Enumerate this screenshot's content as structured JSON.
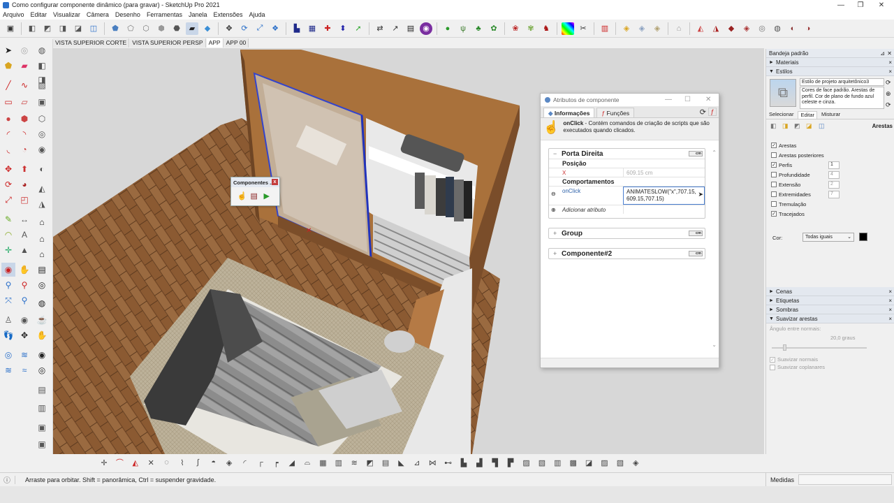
{
  "window": {
    "title": "Como configurar componente dinâmico (para gravar) - SketchUp Pro 2021",
    "minimize": "—",
    "restore": "❐",
    "close": "✕"
  },
  "menu": [
    "Arquivo",
    "Editar",
    "Visualizar",
    "Câmera",
    "Desenho",
    "Ferramentas",
    "Janela",
    "Extensões",
    "Ajuda"
  ],
  "scene_tabs": [
    "VISTA SUPERIOR CORTE",
    "VISTA SUPERIOR PERSP",
    "APP",
    "APP 00"
  ],
  "components_window": {
    "title": "Componentes ...",
    "close": "x"
  },
  "attributes_window": {
    "title": "Atributos de componente",
    "tab_info": "Informações",
    "tab_functions": "Funções",
    "help_title": "onClick",
    "help_text": " - Contém comandos de criação de scripts que são executados quando clicados.",
    "sections": [
      {
        "name": "Porta Direita",
        "unit": "cm",
        "expander": "−"
      },
      {
        "name": "Group",
        "unit": "cm",
        "expander": "+"
      },
      {
        "name": "Componente#2",
        "unit": "cm",
        "expander": "+"
      }
    ],
    "position_label": "Posição",
    "x_label": "X",
    "x_value": "609.15 cm",
    "behaviors_label": "Comportamentos",
    "onclick_label": "onClick",
    "onclick_value": "ANIMATESLOW(\"x\",707.15, 609.15,707.15)",
    "add_attribute": "Adicionar atributo"
  },
  "tray": {
    "title": "Bandeja padrão",
    "panels": [
      "Materiais",
      "Estilos"
    ],
    "style_name": "Estilo de projeto arquitetônico3",
    "style_desc": "Cores de face padrão. Arestas de perfil. Cor de plano de fundo azul celeste e cinza.",
    "style_tabs": [
      "Selecionar",
      "Editar",
      "Misturar"
    ],
    "edges_label": "Arestas",
    "options": [
      {
        "label": "Arestas",
        "checked": true
      },
      {
        "label": "Arestas posteriores",
        "checked": false
      },
      {
        "label": "Perfis",
        "checked": true,
        "value": "1"
      },
      {
        "label": "Profundidade",
        "checked": false,
        "value": "4"
      },
      {
        "label": "Extensão",
        "checked": false,
        "value": "2"
      },
      {
        "label": "Extremidades",
        "checked": false,
        "value": "7"
      },
      {
        "label": "Tremulação",
        "checked": false
      },
      {
        "label": "Tracejados",
        "checked": true
      }
    ],
    "color_label": "Cor:",
    "color_value": "Todas iguais",
    "color_swatch": "#000000",
    "lower_panels": [
      "Cenas",
      "Etiquetas",
      "Sombras",
      "Suavizar arestas"
    ],
    "smooth_angle_label": "Ângulo entre normais:",
    "smooth_angle_value": "20,0  graus",
    "smooth_normals": "Suavizar normais",
    "soften_coplanar": "Suavizar coplanares"
  },
  "status": {
    "message": "Arraste para orbitar. Shift = panorâmica, Ctrl = suspender gravidade.",
    "measures_label": "Medidas",
    "measures_value": ""
  }
}
